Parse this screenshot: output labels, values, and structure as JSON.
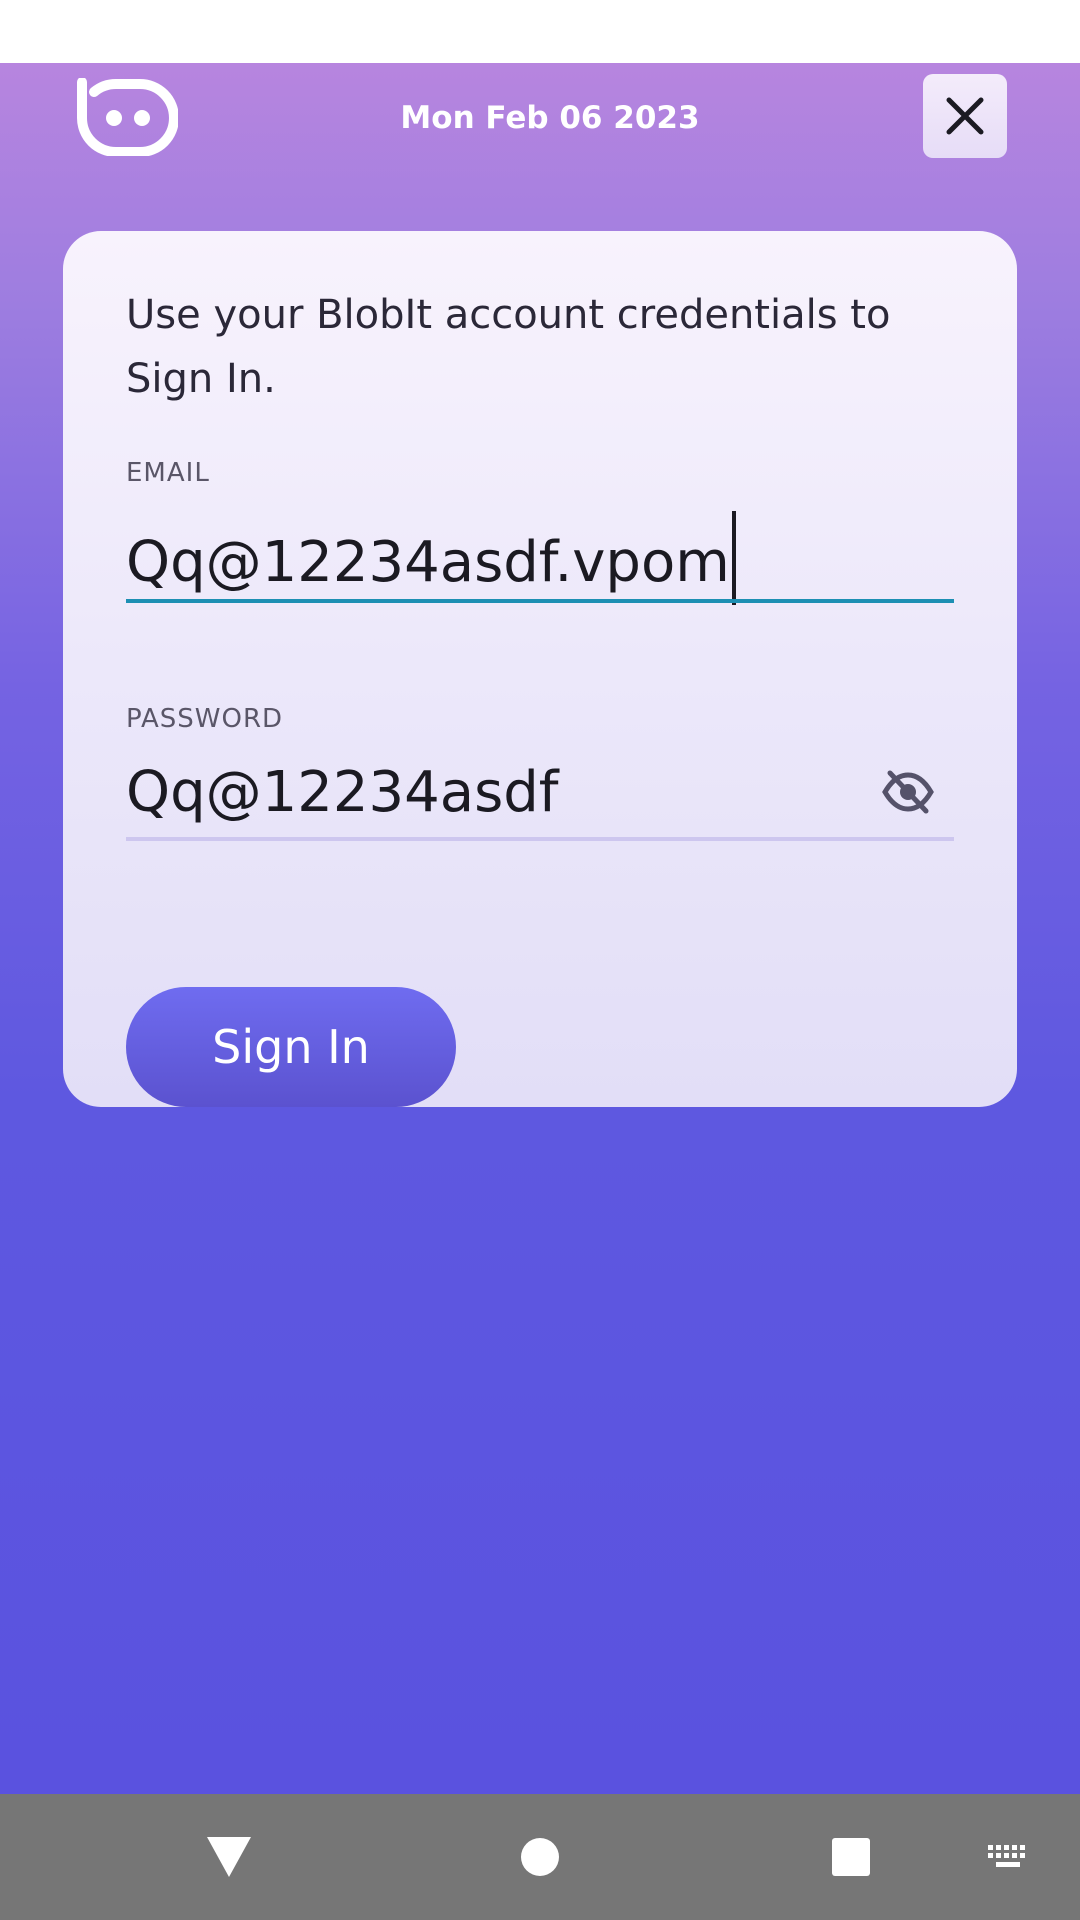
{
  "header": {
    "date": "Mon Feb 06 2023",
    "logo_icon": "blobit-logo-icon",
    "close_icon": "close-icon"
  },
  "card": {
    "intro_text": "Use your BlobIt account credentials to Sign In.",
    "email": {
      "label": "EMAIL",
      "value": "Qq@12234asdf.vpom"
    },
    "password": {
      "label": "PASSWORD",
      "value": "Qq@12234asdf",
      "toggle_icon": "eye-off-icon"
    },
    "signin_label": "Sign In"
  },
  "navbar": {
    "back_icon": "back-triangle-icon",
    "home_icon": "home-circle-icon",
    "recents_icon": "recents-square-icon",
    "keyboard_icon": "keyboard-icon"
  },
  "colors": {
    "accent": "#1c8fb3",
    "button": "#6562e3",
    "gradient_top": "#b785df",
    "gradient_bottom": "#5a52df"
  }
}
